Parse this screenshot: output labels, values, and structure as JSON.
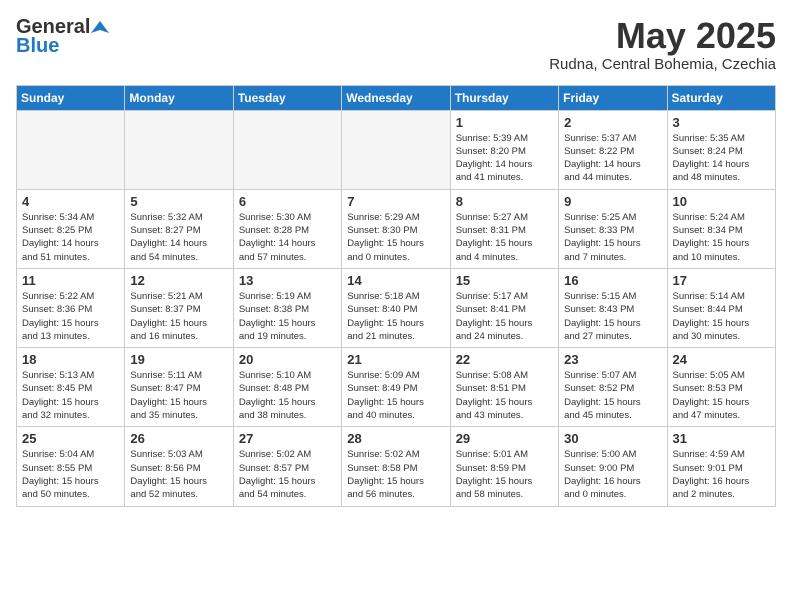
{
  "header": {
    "logo_general": "General",
    "logo_blue": "Blue",
    "month_title": "May 2025",
    "location": "Rudna, Central Bohemia, Czechia"
  },
  "weekdays": [
    "Sunday",
    "Monday",
    "Tuesday",
    "Wednesday",
    "Thursday",
    "Friday",
    "Saturday"
  ],
  "weeks": [
    [
      {
        "day": "",
        "info": ""
      },
      {
        "day": "",
        "info": ""
      },
      {
        "day": "",
        "info": ""
      },
      {
        "day": "",
        "info": ""
      },
      {
        "day": "1",
        "info": "Sunrise: 5:39 AM\nSunset: 8:20 PM\nDaylight: 14 hours\nand 41 minutes."
      },
      {
        "day": "2",
        "info": "Sunrise: 5:37 AM\nSunset: 8:22 PM\nDaylight: 14 hours\nand 44 minutes."
      },
      {
        "day": "3",
        "info": "Sunrise: 5:35 AM\nSunset: 8:24 PM\nDaylight: 14 hours\nand 48 minutes."
      }
    ],
    [
      {
        "day": "4",
        "info": "Sunrise: 5:34 AM\nSunset: 8:25 PM\nDaylight: 14 hours\nand 51 minutes."
      },
      {
        "day": "5",
        "info": "Sunrise: 5:32 AM\nSunset: 8:27 PM\nDaylight: 14 hours\nand 54 minutes."
      },
      {
        "day": "6",
        "info": "Sunrise: 5:30 AM\nSunset: 8:28 PM\nDaylight: 14 hours\nand 57 minutes."
      },
      {
        "day": "7",
        "info": "Sunrise: 5:29 AM\nSunset: 8:30 PM\nDaylight: 15 hours\nand 0 minutes."
      },
      {
        "day": "8",
        "info": "Sunrise: 5:27 AM\nSunset: 8:31 PM\nDaylight: 15 hours\nand 4 minutes."
      },
      {
        "day": "9",
        "info": "Sunrise: 5:25 AM\nSunset: 8:33 PM\nDaylight: 15 hours\nand 7 minutes."
      },
      {
        "day": "10",
        "info": "Sunrise: 5:24 AM\nSunset: 8:34 PM\nDaylight: 15 hours\nand 10 minutes."
      }
    ],
    [
      {
        "day": "11",
        "info": "Sunrise: 5:22 AM\nSunset: 8:36 PM\nDaylight: 15 hours\nand 13 minutes."
      },
      {
        "day": "12",
        "info": "Sunrise: 5:21 AM\nSunset: 8:37 PM\nDaylight: 15 hours\nand 16 minutes."
      },
      {
        "day": "13",
        "info": "Sunrise: 5:19 AM\nSunset: 8:38 PM\nDaylight: 15 hours\nand 19 minutes."
      },
      {
        "day": "14",
        "info": "Sunrise: 5:18 AM\nSunset: 8:40 PM\nDaylight: 15 hours\nand 21 minutes."
      },
      {
        "day": "15",
        "info": "Sunrise: 5:17 AM\nSunset: 8:41 PM\nDaylight: 15 hours\nand 24 minutes."
      },
      {
        "day": "16",
        "info": "Sunrise: 5:15 AM\nSunset: 8:43 PM\nDaylight: 15 hours\nand 27 minutes."
      },
      {
        "day": "17",
        "info": "Sunrise: 5:14 AM\nSunset: 8:44 PM\nDaylight: 15 hours\nand 30 minutes."
      }
    ],
    [
      {
        "day": "18",
        "info": "Sunrise: 5:13 AM\nSunset: 8:45 PM\nDaylight: 15 hours\nand 32 minutes."
      },
      {
        "day": "19",
        "info": "Sunrise: 5:11 AM\nSunset: 8:47 PM\nDaylight: 15 hours\nand 35 minutes."
      },
      {
        "day": "20",
        "info": "Sunrise: 5:10 AM\nSunset: 8:48 PM\nDaylight: 15 hours\nand 38 minutes."
      },
      {
        "day": "21",
        "info": "Sunrise: 5:09 AM\nSunset: 8:49 PM\nDaylight: 15 hours\nand 40 minutes."
      },
      {
        "day": "22",
        "info": "Sunrise: 5:08 AM\nSunset: 8:51 PM\nDaylight: 15 hours\nand 43 minutes."
      },
      {
        "day": "23",
        "info": "Sunrise: 5:07 AM\nSunset: 8:52 PM\nDaylight: 15 hours\nand 45 minutes."
      },
      {
        "day": "24",
        "info": "Sunrise: 5:05 AM\nSunset: 8:53 PM\nDaylight: 15 hours\nand 47 minutes."
      }
    ],
    [
      {
        "day": "25",
        "info": "Sunrise: 5:04 AM\nSunset: 8:55 PM\nDaylight: 15 hours\nand 50 minutes."
      },
      {
        "day": "26",
        "info": "Sunrise: 5:03 AM\nSunset: 8:56 PM\nDaylight: 15 hours\nand 52 minutes."
      },
      {
        "day": "27",
        "info": "Sunrise: 5:02 AM\nSunset: 8:57 PM\nDaylight: 15 hours\nand 54 minutes."
      },
      {
        "day": "28",
        "info": "Sunrise: 5:02 AM\nSunset: 8:58 PM\nDaylight: 15 hours\nand 56 minutes."
      },
      {
        "day": "29",
        "info": "Sunrise: 5:01 AM\nSunset: 8:59 PM\nDaylight: 15 hours\nand 58 minutes."
      },
      {
        "day": "30",
        "info": "Sunrise: 5:00 AM\nSunset: 9:00 PM\nDaylight: 16 hours\nand 0 minutes."
      },
      {
        "day": "31",
        "info": "Sunrise: 4:59 AM\nSunset: 9:01 PM\nDaylight: 16 hours\nand 2 minutes."
      }
    ]
  ]
}
